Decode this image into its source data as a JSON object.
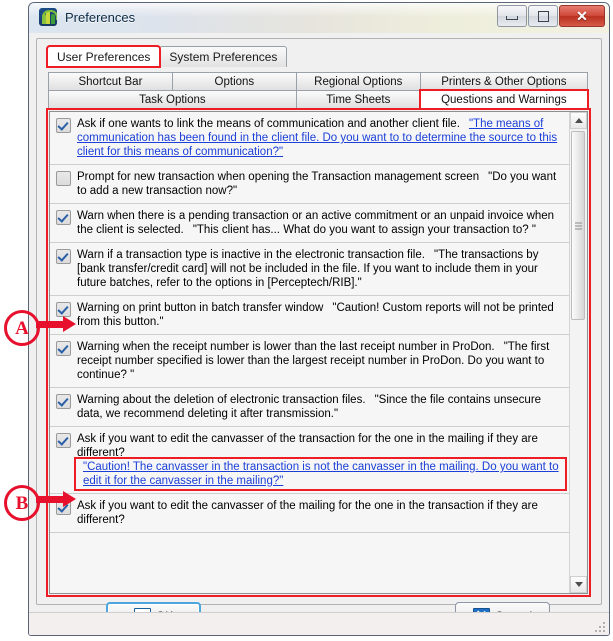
{
  "window": {
    "title": "Preferences",
    "app_icon": "prodon-plant-icon",
    "controls": {
      "minimize": "minimize-icon",
      "maximize": "maximize-icon",
      "close": "✕"
    }
  },
  "main_tabs": [
    {
      "label": "User Preferences",
      "active": true,
      "highlighted": true
    },
    {
      "label": "System Preferences",
      "active": false,
      "highlighted": false
    }
  ],
  "sub_tabs": [
    {
      "label": "Shortcut Bar",
      "active": false,
      "highlighted": false
    },
    {
      "label": "Options",
      "active": false,
      "highlighted": false
    },
    {
      "label": "Regional Options",
      "active": false,
      "highlighted": false
    },
    {
      "label": "Printers & Other Options",
      "active": false,
      "highlighted": false
    },
    {
      "label": "Task Options",
      "active": false,
      "highlighted": false
    },
    {
      "label": "Time Sheets",
      "active": false,
      "highlighted": false
    },
    {
      "label": "Questions and Warnings",
      "active": true,
      "highlighted": true
    }
  ],
  "list": [
    {
      "checked": true,
      "label": "Ask if one wants to link the means of communication and another client file.",
      "message": "\"The means of communication has been found in the client file. Do you want to to determine the source to this client for this means of communication?\"",
      "message_style": "link",
      "boxed": false
    },
    {
      "checked": false,
      "label": "Prompt for new transaction when opening the Transaction management screen",
      "message": "\"Do you want to add a new transaction now?\"",
      "message_style": "plain",
      "boxed": false
    },
    {
      "checked": true,
      "label": "Warn when there is a pending transaction or an active commitment or an unpaid invoice when the client is selected.",
      "message": "\"This client has... What do you want to assign your transaction to? \"",
      "message_style": "plain",
      "boxed": false
    },
    {
      "checked": true,
      "label": "Warn if a transaction type is inactive in the electronic transaction file.",
      "message": "\"The transactions by [bank transfer/credit card] will not be included in the file.  If you want to include them in your future batches, refer to the options in [Perceptech/RIB].\"",
      "message_style": "plain",
      "boxed": false
    },
    {
      "checked": true,
      "label": "Warning on print button in batch transfer window",
      "message": "\"Caution! Custom reports will not be printed from this button.\"",
      "message_style": "plain",
      "boxed": false
    },
    {
      "checked": true,
      "label": "Warning when the receipt number is lower than the last receipt number in ProDon.",
      "message": "\"The first receipt number specified is lower than the largest receipt number in ProDon. Do you want to continue? \"",
      "message_style": "plain",
      "boxed": false
    },
    {
      "checked": true,
      "label": "Warning about the deletion of electronic transaction files.",
      "message": "\"Since the file contains unsecure data, we recommend deleting it after transmission.\"",
      "message_style": "plain",
      "boxed": false
    },
    {
      "checked": true,
      "label": "Ask if you want to edit the canvasser of the transaction for the one in the mailing if they are different?",
      "message": "\"Caution! The canvasser in the transaction is not the canvasser in the mailing. Do you want to edit it for the canvasser in the mailing?\"",
      "message_style": "link",
      "boxed": true
    },
    {
      "checked": true,
      "label": "Ask if you want to edit the canvasser of the mailing for the one in the transaction if they are different?",
      "message": "",
      "message_style": "plain",
      "boxed": false
    }
  ],
  "buttons": {
    "ok": "OK",
    "ok_mnemonic": "O",
    "cancel": "Cancel",
    "cancel_mnemonic": "a"
  },
  "annotations": [
    {
      "id": "A",
      "label": "A"
    },
    {
      "id": "B",
      "label": "B"
    }
  ],
  "colors": {
    "annotation_red": "#ee1c25",
    "link_blue": "#1b3fd8",
    "titlebar_start": "#dbe6f0",
    "titlebar_end": "#f2f1e2",
    "close_button": "#cf4a3a"
  }
}
